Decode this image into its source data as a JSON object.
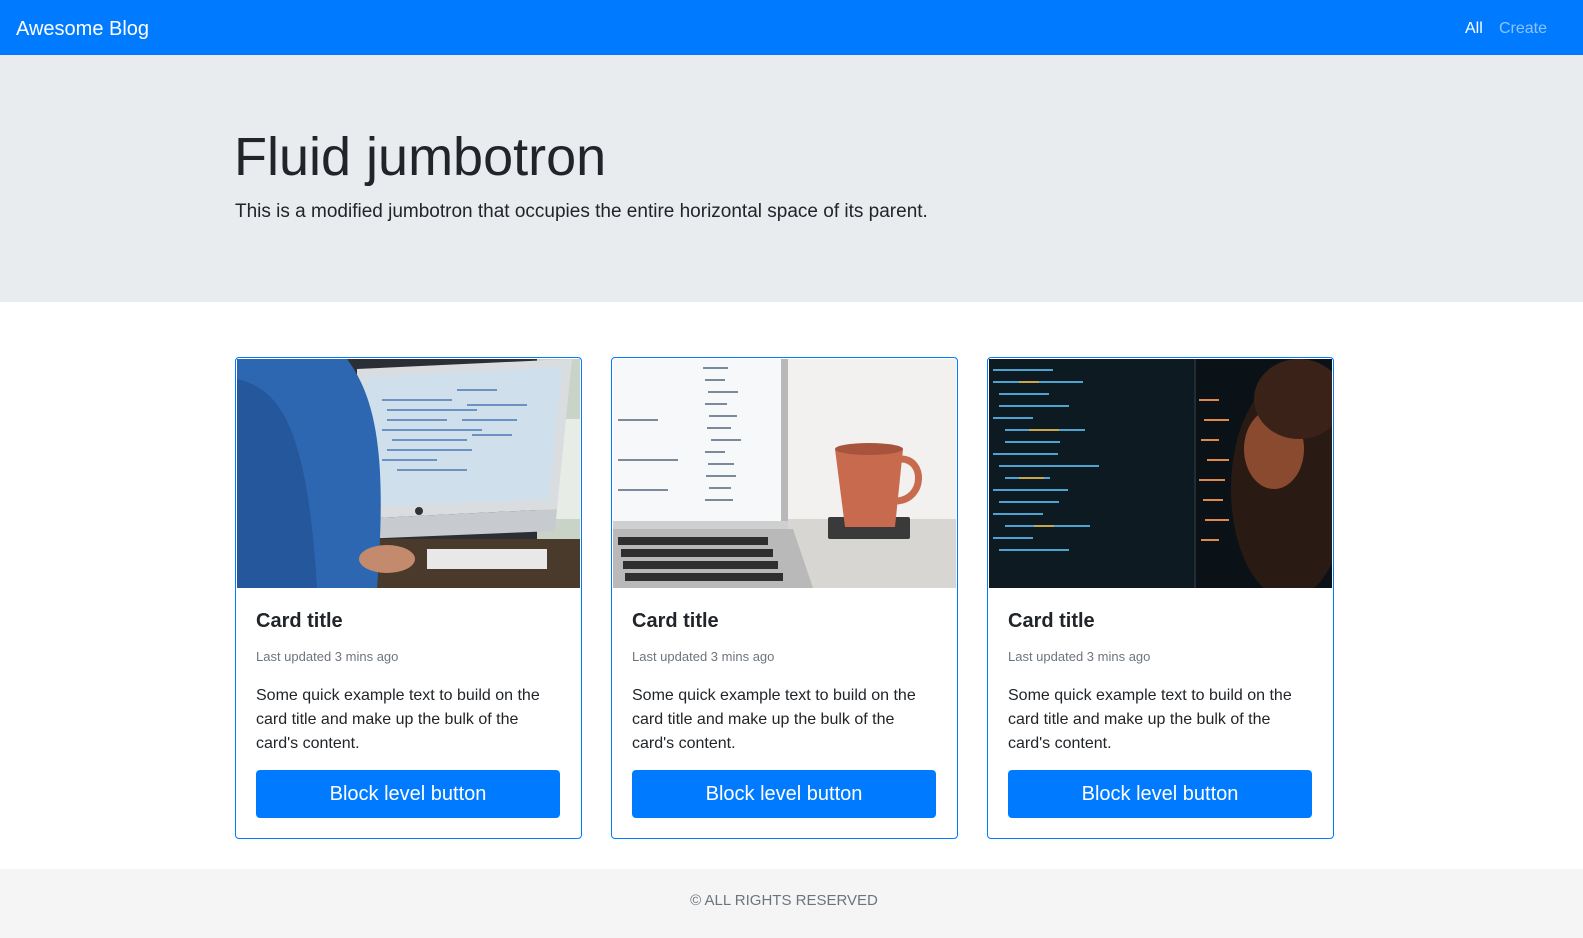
{
  "navbar": {
    "brand": "Awesome Blog",
    "links": [
      {
        "label": "All",
        "active": true
      },
      {
        "label": "Create",
        "active": false
      }
    ],
    "color": "#007bff"
  },
  "jumbotron": {
    "title": "Fluid jumbotron",
    "lead": "This is a modified jumbotron that occupies the entire horizontal space of its parent."
  },
  "cards": [
    {
      "image": "photo-person-at-imac-coding",
      "title": "Card title",
      "meta": "Last updated 3 mins ago",
      "text": "Some quick example text to build on the card title and make up the bulk of the card's content.",
      "button": "Block level button"
    },
    {
      "image": "photo-laptop-with-coffee-cup",
      "title": "Card title",
      "meta": "Last updated 3 mins ago",
      "text": "Some quick example text to build on the card title and make up the bulk of the card's content.",
      "button": "Block level button"
    },
    {
      "image": "photo-developer-dark-monitor-code",
      "title": "Card title",
      "meta": "Last updated 3 mins ago",
      "text": "Some quick example text to build on the card title and make up the bulk of the card's content.",
      "button": "Block level button"
    }
  ],
  "footer": {
    "text": "© ALL RIGHTS RESERVED"
  }
}
